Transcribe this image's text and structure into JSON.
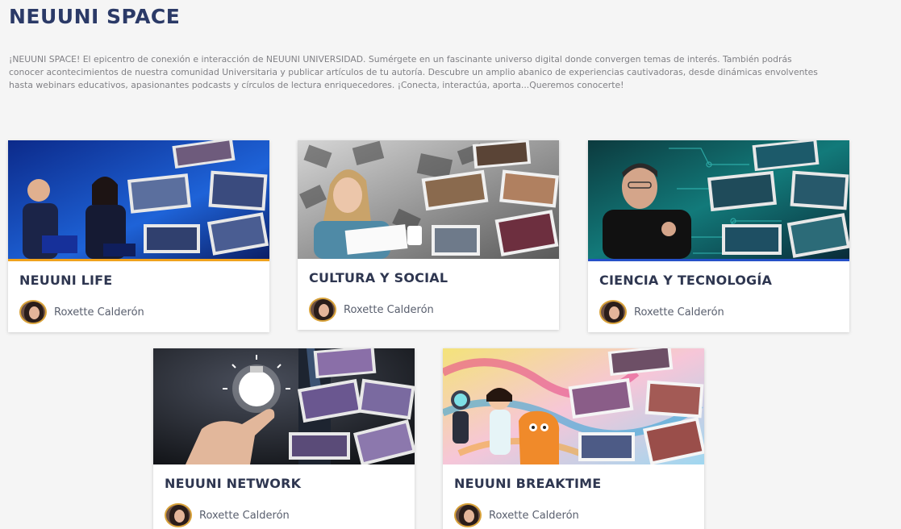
{
  "page": {
    "title": "NEUUNI SPACE",
    "intro": "¡NEUUNI SPACE! El epicentro de conexión e interacción de NEUUNI UNIVERSIDAD. Sumérgete en un fascinante universo digital donde convergen temas de interés. También podrás conocer acontecimientos de nuestra comunidad Universitaria y publicar artículos de tu autoría. Descubre un amplio abanico de experiencias cautivadoras, desde dinámicas envolventes hasta webinars educativos, apasionantes podcasts y círculos de lectura enriquecedores. ¡Conecta, interactúa, aporta...Queremos conocerte!"
  },
  "cards": [
    {
      "title": "NEUUNI LIFE",
      "author": "Roxette Calderón",
      "accent": "#f0a21d"
    },
    {
      "title": "CULTURA Y SOCIAL",
      "author": "Roxette Calderón",
      "accent": "#e6e6e6"
    },
    {
      "title": "CIENCIA Y TECNOLOGÍA",
      "author": "Roxette Calderón",
      "accent": "#2550c8"
    },
    {
      "title": "NEUUNI NETWORK",
      "author": "Roxette Calderón",
      "accent": "#9a86b8"
    },
    {
      "title": "NEUUNI BREAKTIME",
      "author": "Roxette Calderón",
      "accent": "#f2cf5a"
    }
  ],
  "colors": {
    "title": "#2b3a67",
    "background": "#f5f5f5",
    "card": "#ffffff"
  }
}
